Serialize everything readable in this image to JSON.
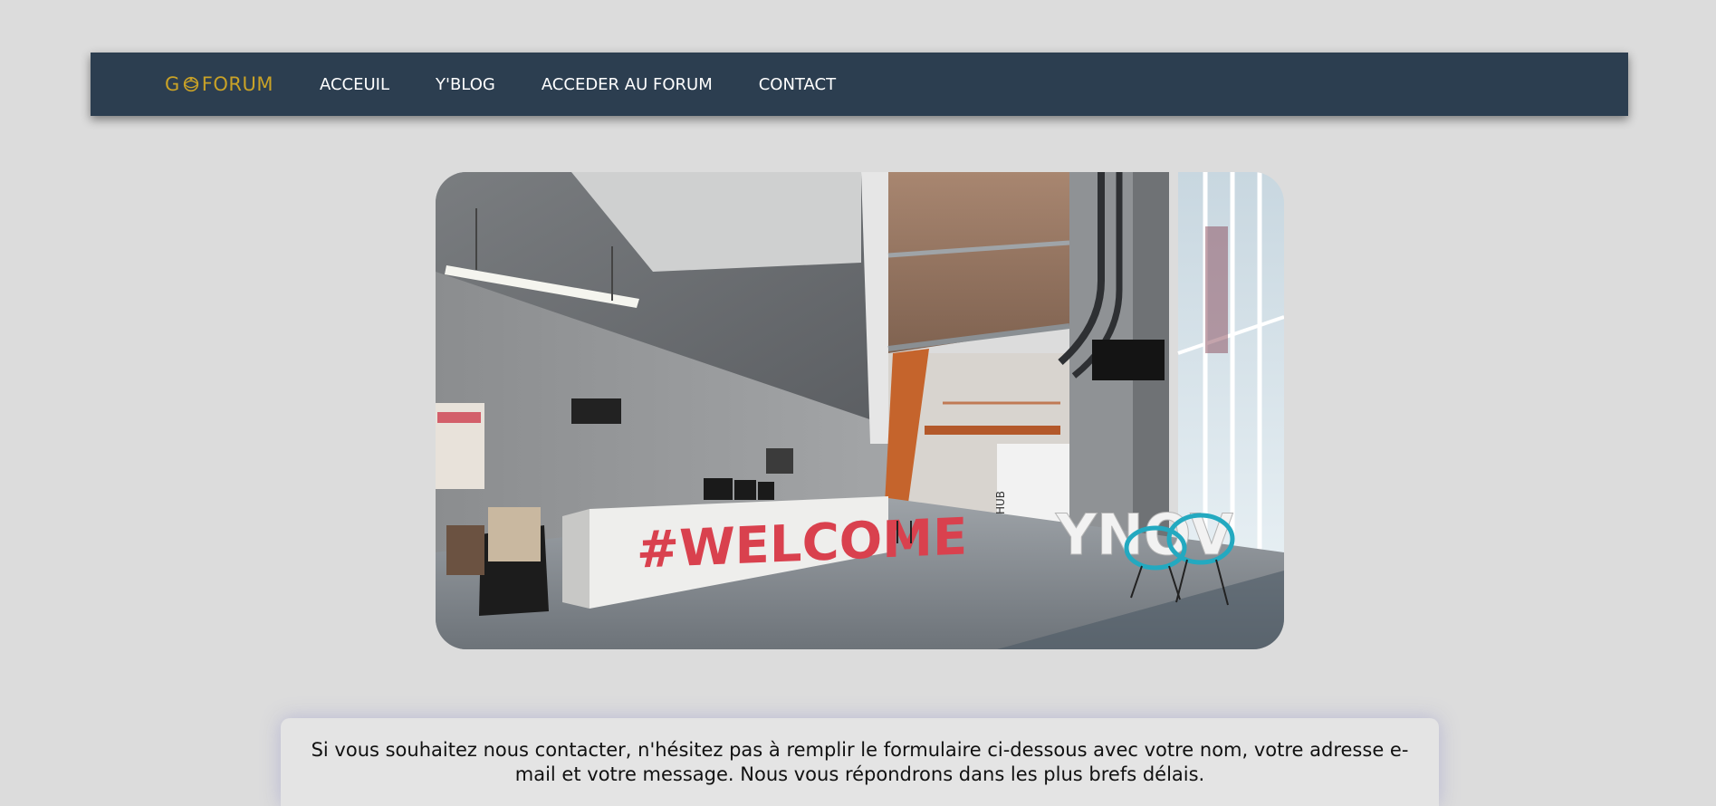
{
  "nav": {
    "logo_left": "G",
    "logo_right": "FORUM",
    "items": [
      {
        "label": "ACCEUIL"
      },
      {
        "label": "Y'BLOG"
      },
      {
        "label": "ACCEDER AU FORUM"
      },
      {
        "label": "CONTACT"
      }
    ]
  },
  "hero": {
    "sign_text": "#WELCOME",
    "wall_letters": "YNOV",
    "wall_sign": "HUB"
  },
  "contact": {
    "intro": "Si vous souhaitez nous contacter, n'hésitez pas à remplir le formulaire ci-dessous avec votre nom, votre adresse e-mail et votre message. Nous vous répondrons dans les plus brefs délais."
  },
  "colors": {
    "background": "#dcdcdc",
    "navbar": "#2c3e50",
    "logo": "#c9a227",
    "welcome_red": "#d9414e"
  }
}
